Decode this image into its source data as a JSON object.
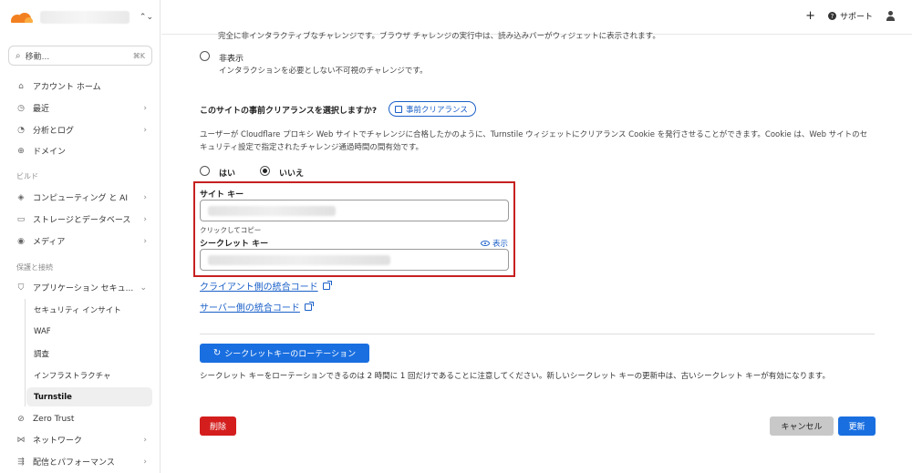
{
  "account": {
    "switcher_icon": "⌃⌄"
  },
  "search": {
    "label": "移動...",
    "shortcut": "⌘K"
  },
  "sidebar": {
    "items_top": [
      {
        "label": "アカウント ホーム",
        "icon": "home-icon",
        "glyph": "⌂"
      },
      {
        "label": "最近",
        "icon": "clock-icon",
        "glyph": "◷",
        "chevron": true
      },
      {
        "label": "分析とログ",
        "icon": "chart-icon",
        "glyph": "◔",
        "chevron": true
      },
      {
        "label": "ドメイン",
        "icon": "globe-icon",
        "glyph": "⊕"
      }
    ],
    "section_build": "ビルド",
    "items_build": [
      {
        "label": "コンピューティング と AI",
        "icon": "compute-icon",
        "glyph": "◈",
        "chevron": true
      },
      {
        "label": "ストレージとデータベース",
        "icon": "folder-icon",
        "glyph": "▭",
        "chevron": true
      },
      {
        "label": "メディア",
        "icon": "media-icon",
        "glyph": "◉",
        "chevron": true
      }
    ],
    "section_protect": "保護と接続",
    "app_security": {
      "label": "アプリケーション セキュ...",
      "icon": "shield-icon",
      "glyph": "⛉"
    },
    "sub_items": [
      {
        "label": "セキュリティ インサイト"
      },
      {
        "label": "WAF"
      },
      {
        "label": "調査"
      },
      {
        "label": "インフラストラクチャ"
      },
      {
        "label": "Turnstile",
        "active": true
      }
    ],
    "items_bottom": [
      {
        "label": "Zero Trust",
        "icon": "zero-trust-icon",
        "glyph": "⊘"
      },
      {
        "label": "ネットワーク",
        "icon": "network-icon",
        "glyph": "⋈",
        "chevron": true
      },
      {
        "label": "配信とパフォーマンス",
        "icon": "delivery-icon",
        "glyph": "⇶",
        "chevron": true
      }
    ]
  },
  "topbar": {
    "add_label": "+",
    "support_label": "サポート"
  },
  "main": {
    "cut_text": "完全に非インタラクティブなチャレンジです。ブラウザ チャレンジの実行中は、読み込みバーがウィジェットに表示されます。",
    "invisible_option": {
      "title": "非表示",
      "desc": "インタラクションを必要としない不可視のチャレンジです。"
    },
    "preclearance": {
      "question": "このサイトの事前クリアランスを選択しますか?",
      "doc_button": "事前クリアランス",
      "desc": "ユーザーが Cloudflare プロキシ Web サイトでチャレンジに合格したかのように、Turnstile ウィジェットにクリアランス Cookie を発行させることができます。Cookie は、Web サイトのセキュリティ設定で指定されたチャレンジ通過時間の間有効です。",
      "yes": "はい",
      "no": "いいえ",
      "selected": "no"
    },
    "site_key": {
      "label": "サイト キー",
      "hint": "クリックしてコピー"
    },
    "secret_key": {
      "label": "シークレット キー",
      "show": "表示"
    },
    "client_link": "クライアント側の統合コード",
    "server_link": "サーバー側の統合コード",
    "rotate_button": "シークレットキーのローテーション",
    "rotate_note": "シークレット キーをローテーションできるのは 2 時間に 1 回だけであることに注意してください。新しいシークレット キーの更新中は、古いシークレット キーが有効になります。",
    "delete_button": "削除",
    "cancel_button": "キャンセル",
    "update_button": "更新"
  },
  "colors": {
    "accent": "#1a6fe0",
    "danger": "#d41e1e",
    "highlight_box": "#c62020",
    "brand": "#f38020"
  }
}
